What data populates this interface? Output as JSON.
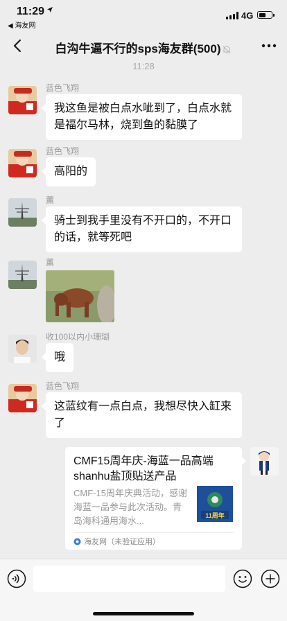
{
  "status_bar": {
    "time": "11:29",
    "back_app": "◀ 海友网",
    "network": "4G"
  },
  "nav": {
    "title": "白沟牛逼不行的sps海友群(500)"
  },
  "timestamp": "11:28",
  "messages": [
    {
      "sender": "蓝色飞翔",
      "text": "我这鱼是被白点水呲到了，白点水就是福尔马林，烧到鱼的黏膜了"
    },
    {
      "sender": "蓝色飞翔",
      "text": "高阳的"
    },
    {
      "sender": "薰",
      "text": "骑士到我手里没有不开口的，不开口的话，就等死吧"
    },
    {
      "sender": "薰",
      "image": "monkey-photo"
    },
    {
      "sender": "收100以内小珊瑚",
      "text": "哦"
    },
    {
      "sender": "蓝色飞翔",
      "text": "这蓝纹有一点白点，我想尽快入缸来了"
    }
  ],
  "link_card": {
    "title": "CMF15周年庆-海蓝一品高端shanhu盐顶贴送产品",
    "description": "CMF-15周年庆典活动，感谢海蓝一品参与此次活动。青岛海科通用海水...",
    "source": "海友网（未验证应用）",
    "thumb_caption": "11周年"
  },
  "colors": {
    "background": "#ededed",
    "bubble": "#ffffff",
    "meta_text": "#999999"
  }
}
